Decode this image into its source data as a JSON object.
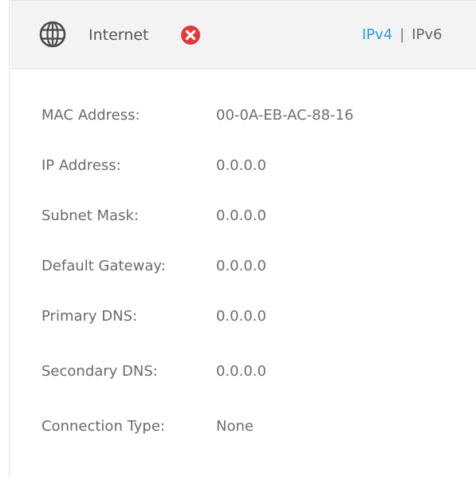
{
  "header": {
    "title": "Internet",
    "status_icon": "error-x-icon",
    "tabs": [
      {
        "label": "IPv4",
        "active": true
      },
      {
        "label": "IPv6",
        "active": false
      }
    ],
    "tab_separator": "|"
  },
  "colors": {
    "accent": "#2b9fd4",
    "error": "#e0393e",
    "header_bg": "#f3f3f3",
    "text": "#6a6a6a"
  },
  "fields": [
    {
      "label": "MAC Address:",
      "value": "00-0A-EB-AC-88-16"
    },
    {
      "label": "IP Address:",
      "value": "0.0.0.0"
    },
    {
      "label": "Subnet Mask:",
      "value": "0.0.0.0"
    },
    {
      "label": "Default Gateway:",
      "value": "0.0.0.0"
    },
    {
      "label": "Primary DNS:",
      "value": "0.0.0.0"
    },
    {
      "label": "Secondary DNS:",
      "value": "0.0.0.0"
    },
    {
      "label": "Connection Type:",
      "value": "None"
    }
  ]
}
